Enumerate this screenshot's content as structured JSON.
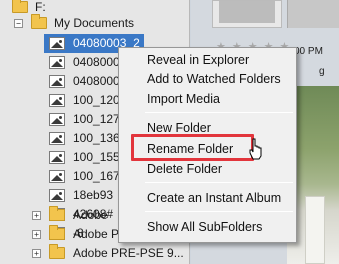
{
  "tree": {
    "drive": {
      "label": "F:"
    },
    "my_documents": {
      "label": "My Documents"
    },
    "children": [
      {
        "label": "04080003_2",
        "selected": true
      },
      {
        "label": "0408000"
      },
      {
        "label": "0408000"
      },
      {
        "label": "100_120"
      },
      {
        "label": "100_127"
      },
      {
        "label": "100_136"
      },
      {
        "label": "100_155"
      },
      {
        "label": "100_167"
      },
      {
        "label": "18eb93"
      },
      {
        "label": "42608#"
      },
      {
        "label": "-8"
      }
    ],
    "siblings": [
      {
        "label": "Adobe"
      },
      {
        "label": "Adobe PRE 8 Proj..."
      },
      {
        "label": "Adobe PRE-PSE 9..."
      }
    ]
  },
  "content": {
    "stars": "★★★★★",
    "timestamp": "00 PM",
    "tag": "g"
  },
  "context_menu": {
    "items": [
      {
        "label": "Reveal in Explorer"
      },
      {
        "label": "Add to Watched Folders"
      },
      {
        "label": "Import Media"
      },
      {
        "label": "New Folder"
      },
      {
        "label": "Rename Folder",
        "highlighted": true
      },
      {
        "label": "Delete Folder"
      },
      {
        "label": "Create an Instant Album"
      },
      {
        "label": "Show All SubFolders"
      }
    ]
  },
  "colors": {
    "highlight_border": "#e2353c",
    "selection": "#3a78c6"
  }
}
